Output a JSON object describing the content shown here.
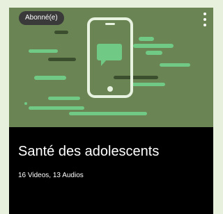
{
  "card": {
    "badge": "Abonné(e)",
    "title": "Santé des adolescents",
    "meta": "16 Videos, 13 Audios",
    "menu_icon": "more-vertical-icon",
    "thumbnail_icon": "smartphone-chat-illustration"
  },
  "colors": {
    "page_bg": "#e6f0dc",
    "thumbnail_bg": "#6b8454",
    "phone_outline": "#e8f2e0",
    "accent_green": "#70c985",
    "dark_line": "#3b4f2e",
    "card_bg": "#000000",
    "text": "#ffffff"
  }
}
